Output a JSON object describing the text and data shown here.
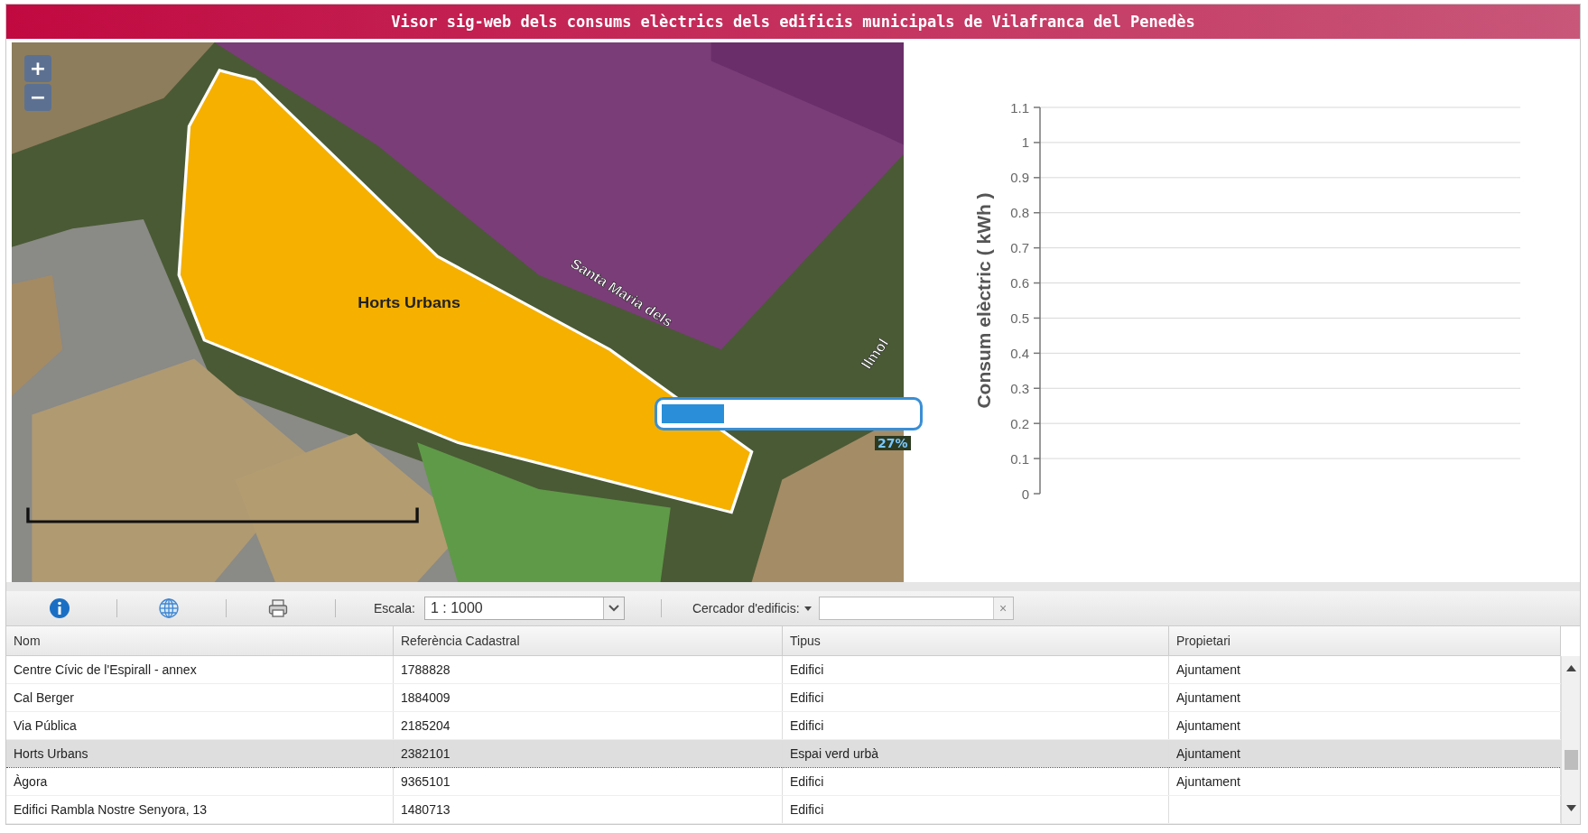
{
  "window": {
    "title": "Visor sig-web dels consums elèctrics dels edificis municipals de Vilafranca del Penedès"
  },
  "map": {
    "zoom_in": "+",
    "zoom_out": "−",
    "feature_label": "Horts Urbans",
    "street_labels": [
      "Santa Maria dels",
      "llmol"
    ],
    "loading": {
      "level": 0.27,
      "text": "27%"
    }
  },
  "chart": {
    "y_axis_title": "Consum elèctric ( kWh )",
    "y_tick_labels": [
      "1.1",
      "1",
      "0.9",
      "0.8",
      "0.7",
      "0.6",
      "0.5",
      "0.4",
      "0.3",
      "0.2",
      "0.1",
      "0"
    ]
  },
  "toolbar": {
    "scale_label": "Escala:",
    "scale_value": "1 : 1000",
    "search_menu": "Cercador d'edificis:",
    "clear": "×"
  },
  "table": {
    "columns": [
      "Nom",
      "Referència Cadastral",
      "Tipus",
      "Propietari"
    ],
    "rows": [
      {
        "cells": [
          "Centre Cívic de l'Espirall - annex",
          "1788828",
          "Edifici",
          "Ajuntament"
        ],
        "selected": false
      },
      {
        "cells": [
          "Cal Berger",
          "1884009",
          "Edifici",
          "Ajuntament"
        ],
        "selected": false
      },
      {
        "cells": [
          "Via Pública",
          "2185204",
          "Edifici",
          "Ajuntament"
        ],
        "selected": false
      },
      {
        "cells": [
          "Horts Urbans",
          "2382101",
          "Espai verd urbà",
          "Ajuntament"
        ],
        "selected": true
      },
      {
        "cells": [
          "Àgora",
          "9365101",
          "Edifici",
          "Ajuntament"
        ],
        "selected": false
      },
      {
        "cells": [
          "Edifici Rambla Nostre Senyora, 13",
          "1480713",
          "Edifici"
        ],
        "selected": false
      }
    ]
  }
}
